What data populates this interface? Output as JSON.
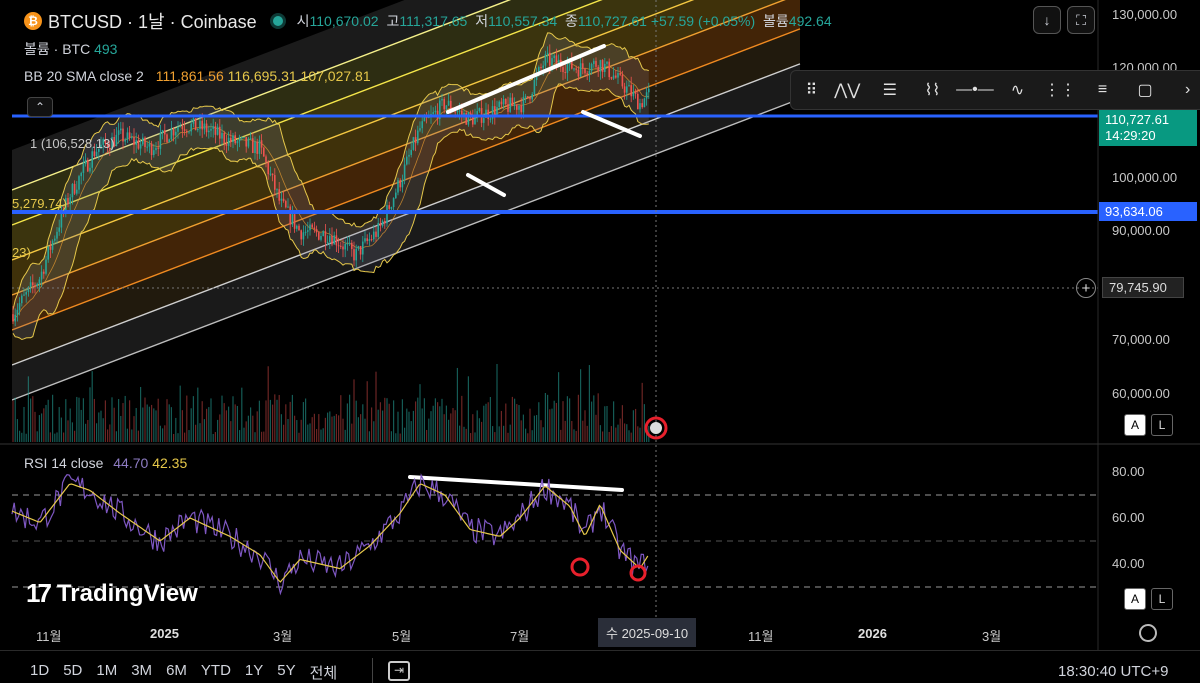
{
  "header": {
    "symbol": "BTCUSD · 1날 · Coinbase",
    "coin_icon": "bitcoin-icon",
    "open_label": "시",
    "open": "110,670.02",
    "high_label": "고",
    "high": "111,317.65",
    "low_label": "저",
    "low": "110,557.34",
    "close_label": "종",
    "close": "110,727.61",
    "change": "+57.59 (+0.05%)",
    "volume_label": "볼륨",
    "volume": "492.64"
  },
  "volume_legend": {
    "label": "볼륨 · BTC",
    "value": "493"
  },
  "bb_legend": {
    "label": "BB 20 SMA close 2",
    "basis": "111,861.56",
    "upper": "116,695.31",
    "lower": "107,027.81"
  },
  "channel_labels": {
    "level1": "1 (106,528.13)",
    "level2": "5,279.74)",
    "level3": "23)"
  },
  "price_axis": {
    "ticks": [
      "130,000.00",
      "120,000.00",
      "100,000.00",
      "90,000.00",
      "70,000.00",
      "60,000.00"
    ],
    "current_price": "110,727.61",
    "countdown": "14:29:20",
    "support_price": "93,634.06",
    "cursor_price": "79,745.90"
  },
  "rsi_legend": {
    "label": "RSI 14 close",
    "rsi": "44.70",
    "ma": "42.35"
  },
  "rsi_axis": {
    "ticks": [
      "80.00",
      "60.00",
      "40.00"
    ]
  },
  "time_axis": {
    "ticks": [
      {
        "label": "11월",
        "bold": false
      },
      {
        "label": "2025",
        "bold": true
      },
      {
        "label": "3월",
        "bold": false
      },
      {
        "label": "5월",
        "bold": false
      },
      {
        "label": "7월",
        "bold": false
      },
      {
        "label": "11월",
        "bold": false
      },
      {
        "label": "2026",
        "bold": true
      },
      {
        "label": "3월",
        "bold": false
      }
    ],
    "cursor_date": "수 2025-09-10"
  },
  "timeframes": [
    "1D",
    "5D",
    "1M",
    "3M",
    "6M",
    "YTD",
    "1Y",
    "5Y",
    "전체"
  ],
  "clock": "18:30:40 UTC+9",
  "brand": "TradingView",
  "scale_buttons": {
    "auto": "A",
    "log": "L"
  },
  "drawing_toolbar": {
    "tools": [
      "drag-handle-icon",
      "pattern-tool-icon",
      "fib-retracement-icon",
      "elliott-wave-icon",
      "horizontal-line-icon",
      "abcd-pattern-icon",
      "parallel-channel-icon",
      "regression-trend-icon",
      "rectangle-icon",
      "more-icon"
    ]
  },
  "colors": {
    "up": "#26a69a",
    "down": "#ef5350",
    "accent_blue": "#2962ff",
    "bb": "#e6c84a",
    "rsi": "#7e57c2",
    "rsi_ma": "#e6c84a",
    "marker": "#e8202c"
  },
  "chart_data": [
    {
      "type": "candlestick",
      "symbol": "BTCUSD",
      "price_axis_ticks": [
        60000,
        70000,
        90000,
        100000,
        120000,
        130000
      ],
      "horizontal_levels": [
        110727.61,
        93634.06
      ],
      "indicator": "Bollinger Bands (20, 2)",
      "bb_values": {
        "basis": 111861.56,
        "upper": 116695.31,
        "lower": 107027.81
      }
    },
    {
      "type": "line",
      "indicator": "RSI 14 close",
      "rsi_axis_ticks": [
        40,
        60,
        80
      ],
      "latest": {
        "rsi": 44.7,
        "ma": 42.35
      }
    }
  ]
}
